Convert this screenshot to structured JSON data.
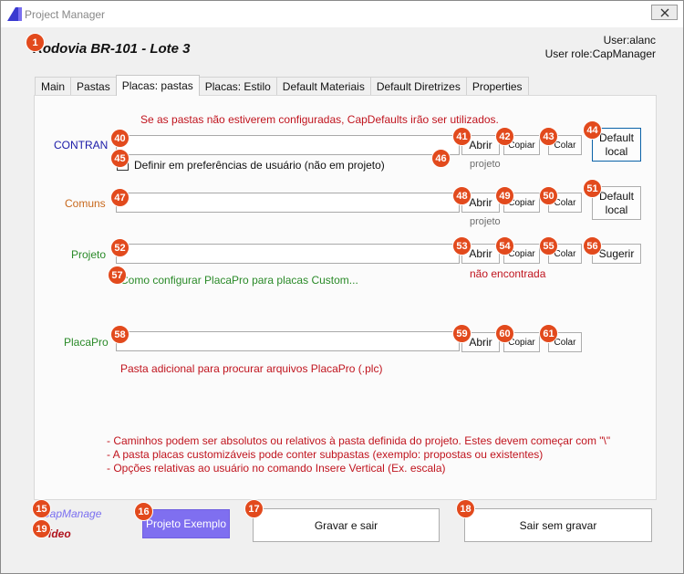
{
  "window": {
    "title": "Project Manager"
  },
  "header": {
    "project_title": "Rodovia BR-101 - Lote 3",
    "user": "User:alanc",
    "user_role": "User role:CapManager"
  },
  "tabs": [
    {
      "label": "Main"
    },
    {
      "label": "Pastas"
    },
    {
      "label": "Placas: pastas"
    },
    {
      "label": "Placas: Estilo"
    },
    {
      "label": "Default Materiais"
    },
    {
      "label": "Default Diretrizes"
    },
    {
      "label": "Properties"
    }
  ],
  "panel": {
    "warning": "Se as pastas não estiverem configuradas, CapDefaults irão ser utilizados.",
    "contran": {
      "label": "CONTRAN",
      "value": "",
      "open": "Abrir",
      "copy": "Copiar",
      "paste": "Colar",
      "default": "Default local",
      "status": "projeto",
      "checkbox_label": "Definir em preferências de usuário (não em projeto)"
    },
    "comuns": {
      "label": "Comuns",
      "value": "",
      "open": "Abrir",
      "copy": "Copiar",
      "paste": "Colar",
      "default": "Default local",
      "status": "projeto"
    },
    "projeto": {
      "label": "Projeto",
      "value": "",
      "open": "Abrir",
      "copy": "Copiar",
      "paste": "Colar",
      "suggest": "Sugerir",
      "status": "não encontrada",
      "link": "Como configurar PlacaPro para placas Custom..."
    },
    "placapro": {
      "label": "PlacaPro",
      "value": "",
      "open": "Abrir",
      "copy": "Copiar",
      "paste": "Colar",
      "note": "Pasta adicional para procurar arquivos PlacaPro (.plc)"
    },
    "notes": [
      "- Caminhos podem ser absolutos ou relativos à pasta definida do projeto. Estes devem começar com \"\\\"",
      "- A pasta placas customizáveis pode conter subpastas (exemplo: propostas ou existentes)",
      "- Opções relativas ao usuário no comando Insere Vertical (Ex. escala)"
    ]
  },
  "footer": {
    "brand_top": "CapManage",
    "brand_bottom": "Vídeo",
    "example_project": "Projeto Exemplo",
    "save_exit": "Gravar e sair",
    "exit_no_save": "Sair sem gravar"
  },
  "badges": {
    "b1": "1",
    "b15": "15",
    "b16": "16",
    "b17": "17",
    "b18": "18",
    "b19": "19",
    "b40": "40",
    "b41": "41",
    "b42": "42",
    "b43": "43",
    "b44": "44",
    "b45": "45",
    "b46": "46",
    "b47": "47",
    "b48": "48",
    "b49": "49",
    "b50": "50",
    "b51": "51",
    "b52": "52",
    "b53": "53",
    "b54": "54",
    "b55": "55",
    "b56": "56",
    "b57": "57",
    "b58": "58",
    "b59": "59",
    "b60": "60",
    "b61": "61"
  },
  "colors": {
    "badge": "#e24a1d",
    "accent_button": "#7f6ff0",
    "warning_text": "#c0141e",
    "label_contran": "#1b1ba8",
    "label_comuns": "#c8681c",
    "label_green": "#2a8a28"
  }
}
